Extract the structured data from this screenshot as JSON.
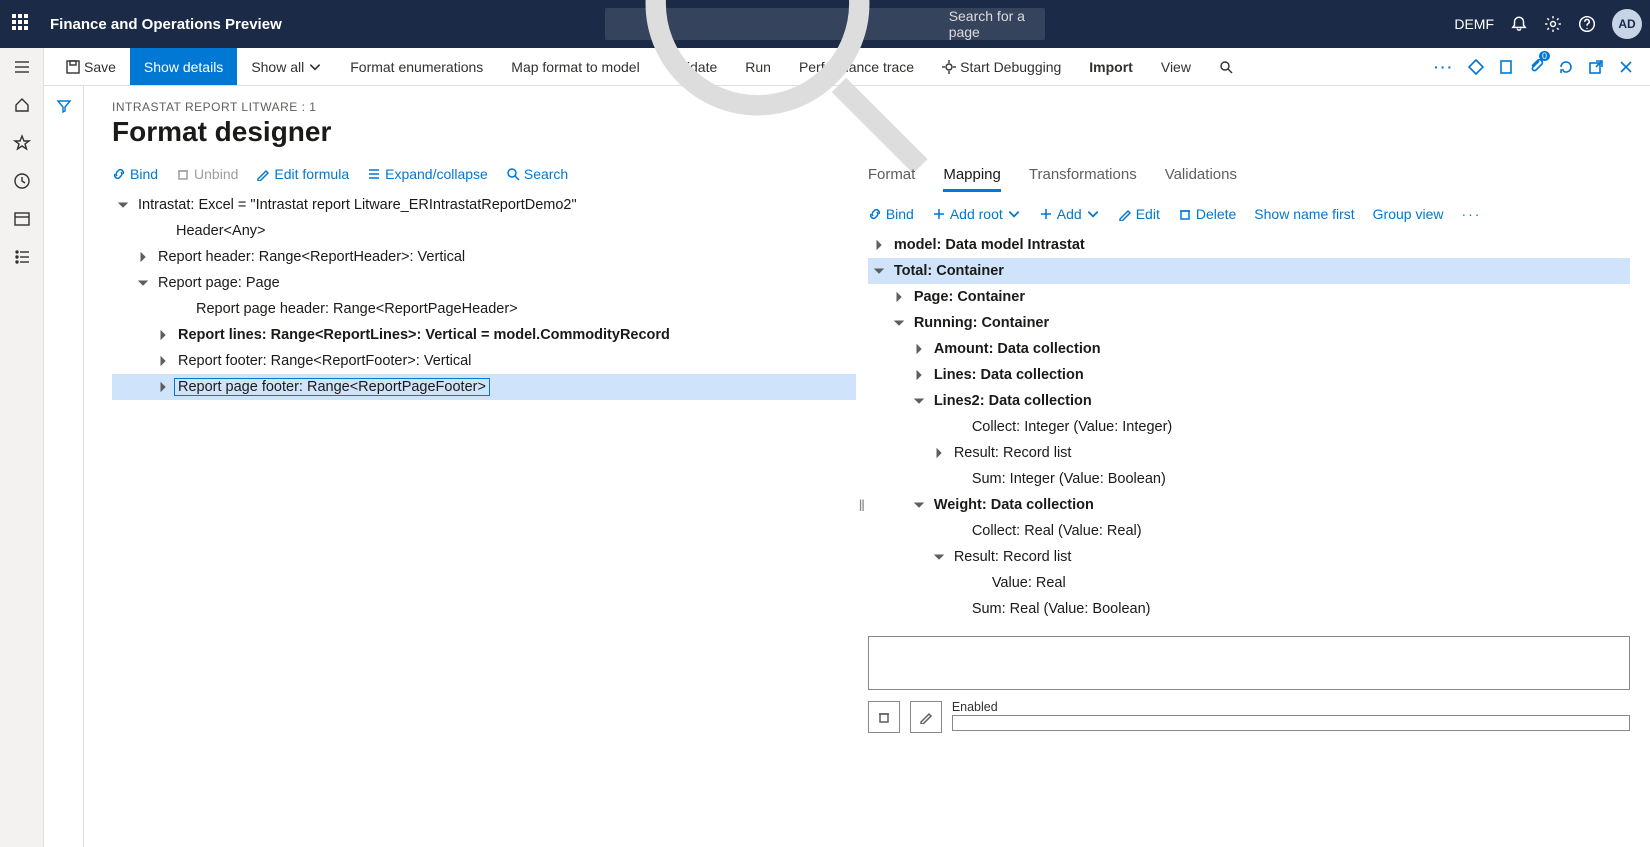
{
  "topbar": {
    "product": "Finance and Operations Preview",
    "search_placeholder": "Search for a page",
    "company": "DEMF",
    "avatar": "AD"
  },
  "cmdbar": {
    "save": "Save",
    "show_details": "Show details",
    "show_all": "Show all",
    "format_enum": "Format enumerations",
    "map": "Map format to model",
    "validate": "Validate",
    "run": "Run",
    "perf": "Performance trace",
    "debug": "Start Debugging",
    "import": "Import",
    "view": "View",
    "badge0": "0"
  },
  "breadcrumb": "INTRASTAT REPORT LITWARE : 1",
  "pagetitle": "Format designer",
  "left_actions": {
    "bind": "Bind",
    "unbind": "Unbind",
    "edit_formula": "Edit formula",
    "expand": "Expand/collapse",
    "search": "Search"
  },
  "left_tree": [
    {
      "level": 0,
      "exp": "open",
      "bold": false,
      "label": "Intrastat: Excel = \"Intrastat report Litware_ERIntrastatReportDemo2\"",
      "selected": false
    },
    {
      "level": 1,
      "exp": "none",
      "bold": false,
      "label": "Header<Any>",
      "selected": false
    },
    {
      "level": 1,
      "exp": "closed",
      "bold": false,
      "label": "Report header: Range<ReportHeader>: Vertical",
      "selected": false
    },
    {
      "level": 1,
      "exp": "open",
      "bold": false,
      "label": "Report page: Page",
      "selected": false
    },
    {
      "level": 2,
      "exp": "none",
      "bold": false,
      "label": "Report page header: Range<ReportPageHeader>",
      "selected": false
    },
    {
      "level": 2,
      "exp": "closed",
      "bold": true,
      "label": "Report lines: Range<ReportLines>: Vertical = model.CommodityRecord",
      "selected": false
    },
    {
      "level": 2,
      "exp": "closed",
      "bold": false,
      "label": "Report footer: Range<ReportFooter>: Vertical",
      "selected": false
    },
    {
      "level": 2,
      "exp": "closed",
      "bold": false,
      "label": "Report page footer: Range<ReportPageFooter>",
      "selected": true
    }
  ],
  "right_tabs": {
    "format": "Format",
    "mapping": "Mapping",
    "transformations": "Transformations",
    "validations": "Validations"
  },
  "right_actions": {
    "bind": "Bind",
    "add_root": "Add root",
    "add": "Add",
    "edit": "Edit",
    "delete": "Delete",
    "show_name_first": "Show name first",
    "group_view": "Group view"
  },
  "right_tree": [
    {
      "level": 0,
      "exp": "closed",
      "bold": true,
      "label": "model: Data model Intrastat"
    },
    {
      "level": 0,
      "exp": "open",
      "bold": true,
      "label": "Total: Container",
      "highlight": true
    },
    {
      "level": 1,
      "exp": "closed",
      "bold": true,
      "label": "Page: Container"
    },
    {
      "level": 1,
      "exp": "open",
      "bold": true,
      "label": "Running: Container"
    },
    {
      "level": 2,
      "exp": "closed",
      "bold": true,
      "label": "Amount: Data collection"
    },
    {
      "level": 2,
      "exp": "closed",
      "bold": true,
      "label": "Lines: Data collection"
    },
    {
      "level": 2,
      "exp": "open",
      "bold": true,
      "label": "Lines2: Data collection"
    },
    {
      "level": 3,
      "exp": "none",
      "bold": false,
      "label": "Collect: Integer (Value: Integer)"
    },
    {
      "level": 3,
      "exp": "closed",
      "bold": false,
      "label": "Result: Record list"
    },
    {
      "level": 3,
      "exp": "none",
      "bold": false,
      "label": "Sum: Integer (Value: Boolean)"
    },
    {
      "level": 2,
      "exp": "open",
      "bold": true,
      "label": "Weight: Data collection"
    },
    {
      "level": 3,
      "exp": "none",
      "bold": false,
      "label": "Collect: Real (Value: Real)"
    },
    {
      "level": 3,
      "exp": "open",
      "bold": false,
      "label": "Result: Record list"
    },
    {
      "level": 4,
      "exp": "none",
      "bold": false,
      "label": "Value: Real"
    },
    {
      "level": 3,
      "exp": "none",
      "bold": false,
      "label": "Sum: Real (Value: Boolean)"
    }
  ],
  "enabled_label": "Enabled"
}
